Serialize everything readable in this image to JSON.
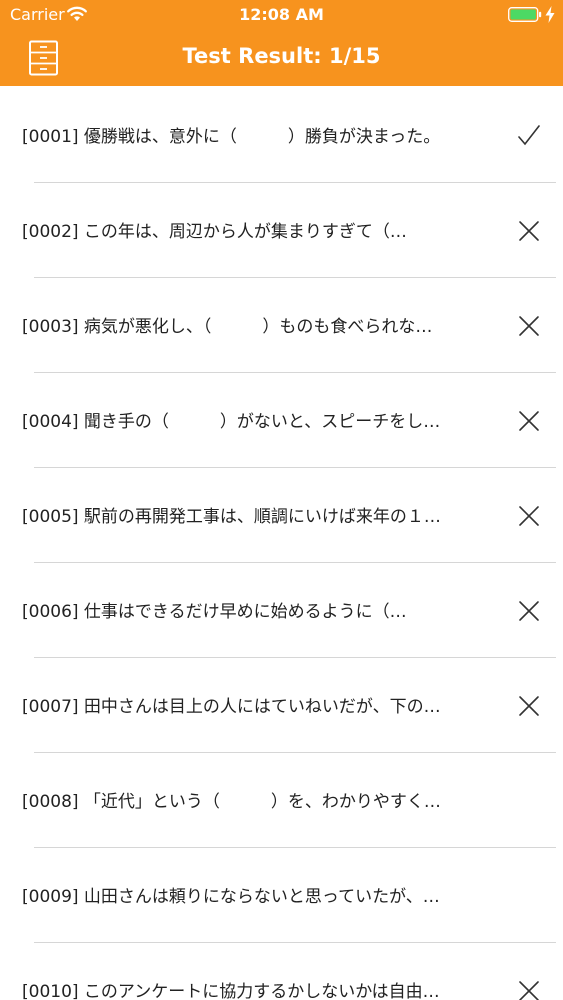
{
  "status_bar": {
    "carrier": "Carrier",
    "time": "12:08 AM",
    "battery_color": "#4CD964",
    "wifi_icon": "wifi-icon",
    "battery_icon": "battery-charging-icon"
  },
  "nav": {
    "title": "Test Result: 1/15",
    "left_icon": "cabinet-menu-icon",
    "background_color": "#F7931E"
  },
  "results": [
    {
      "id": "[0001]",
      "text": "[0001] 優勝戦は、意外に（　　　）勝負が決まった。",
      "mark": "check"
    },
    {
      "id": "[0002]",
      "text": "[0002] この年は、周辺から人が集まりすぎて（…",
      "mark": "cross"
    },
    {
      "id": "[0003]",
      "text": "[0003] 病気が悪化し、（　　　）ものも食べられな…",
      "mark": "cross"
    },
    {
      "id": "[0004]",
      "text": "[0004] 聞き手の（　　　）がないと、スピーチをし…",
      "mark": "cross"
    },
    {
      "id": "[0005]",
      "text": "[0005] 駅前の再開発工事は、順調にいけば来年の１…",
      "mark": "cross"
    },
    {
      "id": "[0006]",
      "text": "[0006] 仕事はできるだけ早めに始めるように（…",
      "mark": "cross"
    },
    {
      "id": "[0007]",
      "text": "[0007] 田中さんは目上の人にはていねいだが、下の…",
      "mark": "cross"
    },
    {
      "id": "[0008]",
      "text": "[0008] 「近代」という（　　　）を、わかりやすく…",
      "mark": "none"
    },
    {
      "id": "[0009]",
      "text": "[0009] 山田さんは頼りにならないと思っていたが、…",
      "mark": "none"
    },
    {
      "id": "[0010]",
      "text": "[0010] このアンケートに協力するかしないかは自由…",
      "mark": "cross"
    }
  ]
}
